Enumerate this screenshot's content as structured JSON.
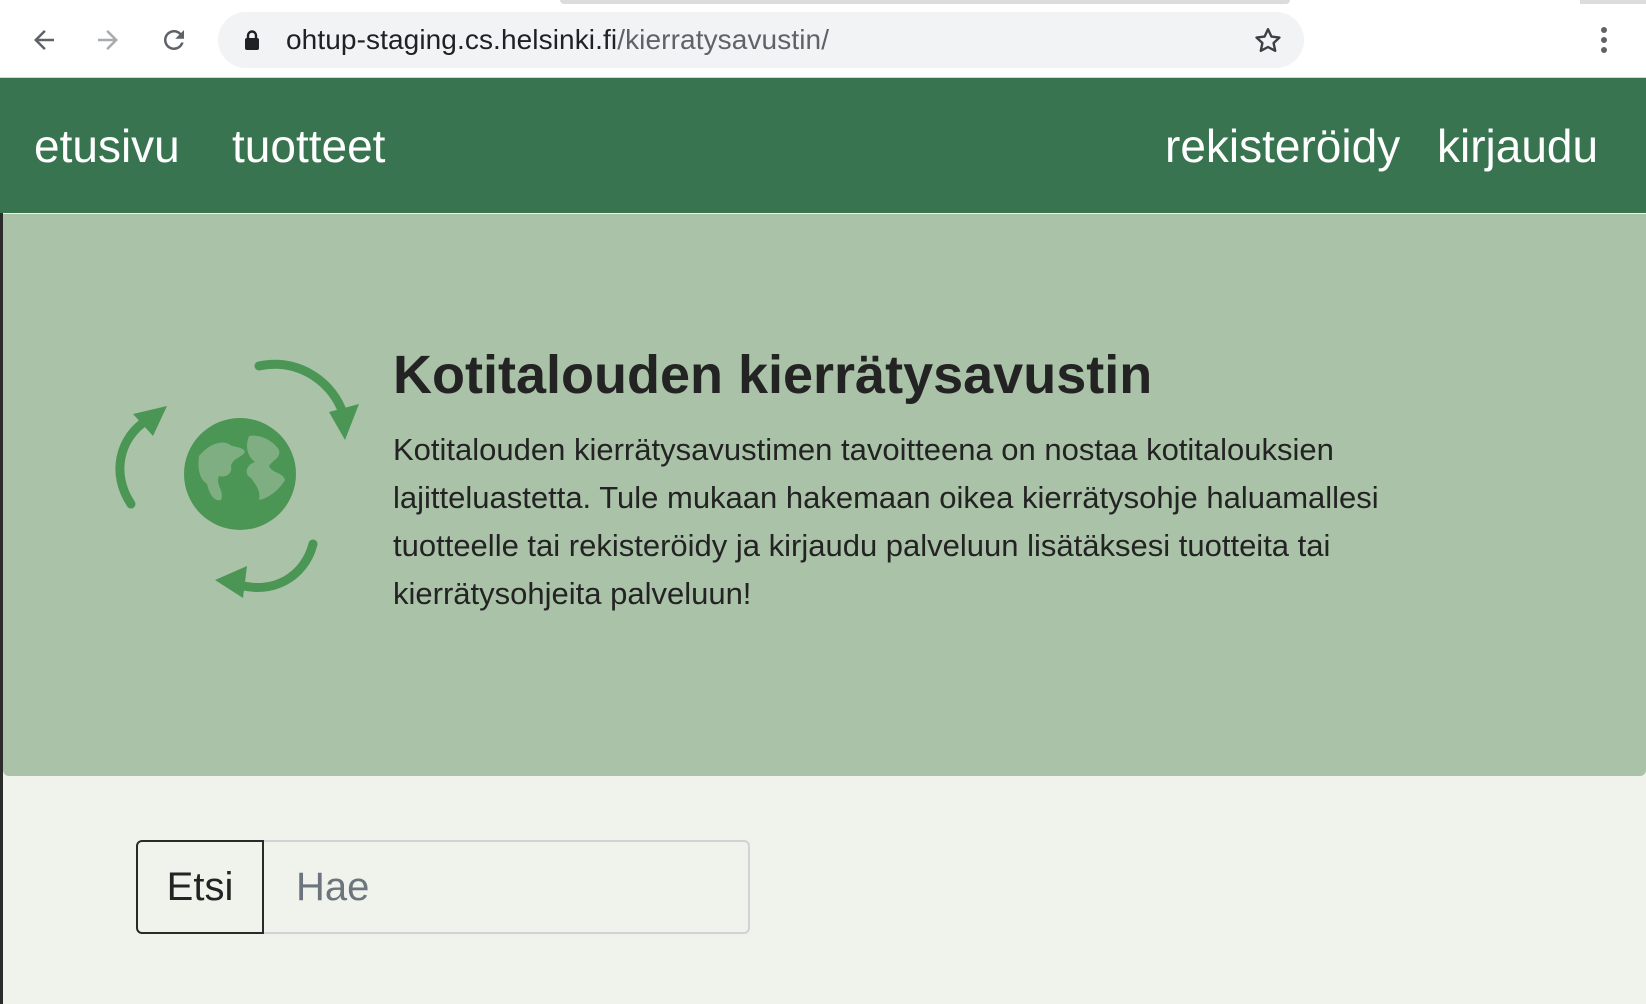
{
  "browser": {
    "url_host": "ohtup-staging.cs.helsinki.fi",
    "url_path": "/kierratysavustin/"
  },
  "nav": {
    "home": "etusivu",
    "products": "tuotteet",
    "register": "rekisteröidy",
    "login": "kirjaudu"
  },
  "hero": {
    "title": "Kotitalouden kierrätysavustin",
    "text": "Kotitalouden kierrätysavustimen tavoitteena on nostaa kotitalouksien lajitteluastetta. Tule mukaan hakemaan oikea kierrätysohje haluamallesi tuotteelle tai rekisteröidy ja kirjaudu palveluun lisätäksesi tuotteita tai kierrätysohjeita palveluun!"
  },
  "search": {
    "button_label": "Etsi",
    "placeholder": "Hae"
  },
  "colors": {
    "nav_background": "#37744f",
    "hero_background": "#aac3a8",
    "page_background": "#f0f2ec",
    "logo_green": "#4b9654"
  },
  "icons": [
    "back-arrow-icon",
    "forward-arrow-icon",
    "reload-icon",
    "lock-icon",
    "star-icon",
    "more-vert-icon",
    "recycle-globe-icon"
  ]
}
